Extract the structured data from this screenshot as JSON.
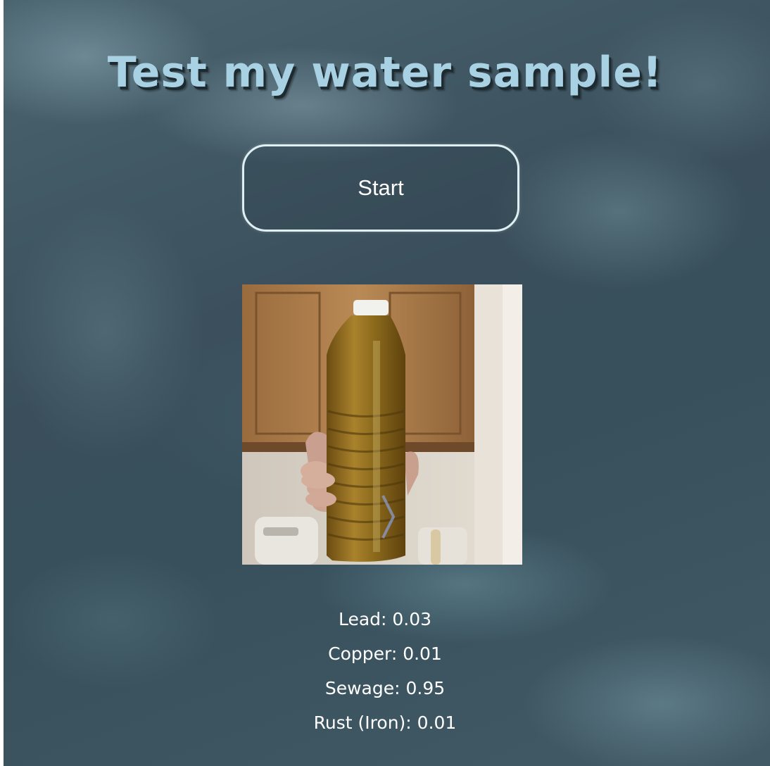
{
  "page": {
    "title": "Test my water sample!"
  },
  "controls": {
    "start_label": "Start"
  },
  "sample_image": {
    "description_icon": "water-bottle-photo"
  },
  "results": [
    {
      "label": "Lead: 0.03"
    },
    {
      "label": "Copper: 0.01"
    },
    {
      "label": "Sewage: 0.95"
    },
    {
      "label": "Rust (Iron): 0.01"
    }
  ],
  "colors": {
    "title": "#a8d2e3",
    "button_border": "#dff0f5",
    "background": "#3c515c",
    "text": "#ffffff"
  }
}
